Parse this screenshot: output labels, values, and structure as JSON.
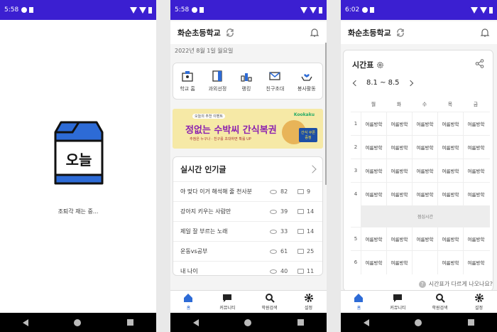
{
  "screens": [
    {
      "status": {
        "time": "5:58"
      },
      "splash": {
        "logo_text": "오늘",
        "loading": "조퇴각 재는 중..."
      }
    },
    {
      "status": {
        "time": "5:58"
      },
      "header": {
        "title": "화순초등학교"
      },
      "date": "2022년 8월 1일 월요일",
      "menu": [
        {
          "label": "학교 홈",
          "icon": "school-home-icon"
        },
        {
          "label": "과외선정",
          "icon": "book-icon"
        },
        {
          "label": "랭킹",
          "icon": "ranking-podium-icon"
        },
        {
          "label": "친구초대",
          "icon": "mail-icon"
        },
        {
          "label": "봉사활동",
          "icon": "volunteer-hands-icon"
        }
      ],
      "banner": {
        "small": "오늘의 추천 이벤트",
        "headline": "정없는 수박씨 간식복권",
        "sub": "추첨은 누구나 · 친구를 초대하면 확률 UP",
        "logo": "Kookaku",
        "tag": "간식 쿠폰 증정"
      },
      "popular": {
        "title": "실시간 인기글",
        "posts": [
          {
            "title": "야 맞다 이거 해석해 줄 천사분",
            "views": "82",
            "comments": "9"
          },
          {
            "title": "강아지 키우는 사람만",
            "views": "39",
            "comments": "14"
          },
          {
            "title": "제일 잘 부르는 노래",
            "views": "33",
            "comments": "14"
          },
          {
            "title": "운동vs공부",
            "views": "61",
            "comments": "25"
          },
          {
            "title": "내 나이",
            "views": "40",
            "comments": "11"
          }
        ]
      },
      "tabs": [
        "홈",
        "커뮤니티",
        "학원검색",
        "설정"
      ]
    },
    {
      "status": {
        "time": "6:02"
      },
      "header": {
        "title": "화순초등학교"
      },
      "timetable": {
        "title": "시간표",
        "week": "8.1 ~ 8.5",
        "days": [
          "월",
          "화",
          "수",
          "목",
          "금"
        ],
        "rows": [
          {
            "n": "1",
            "cells": [
              "여름방학",
              "여름방학",
              "여름방학",
              "여름방학",
              "여름방학"
            ]
          },
          {
            "n": "2",
            "cells": [
              "여름방학",
              "여름방학",
              "여름방학",
              "여름방학",
              "여름방학"
            ]
          },
          {
            "n": "3",
            "cells": [
              "여름방학",
              "여름방학",
              "여름방학",
              "여름방학",
              "여름방학"
            ]
          },
          {
            "n": "4",
            "cells": [
              "여름방학",
              "여름방학",
              "여름방학",
              "여름방학",
              "여름방학"
            ]
          }
        ],
        "lunch": "점심시간",
        "rows2": [
          {
            "n": "5",
            "cells": [
              "여름방학",
              "여름방학",
              "여름방학",
              "여름방학",
              "여름방학"
            ]
          },
          {
            "n": "6",
            "cells": [
              "여름방학",
              "여름방학",
              "",
              "여름방학",
              "여름방학"
            ]
          }
        ],
        "help": "시간표가 다르게 나오나요?"
      },
      "tabs": [
        "홈",
        "커뮤니티",
        "학원검색",
        "설정"
      ]
    }
  ],
  "colors": {
    "status_bar": "#3b1fd1",
    "accent": "#2d6bd6",
    "milk_blue": "#2d6bd6"
  }
}
